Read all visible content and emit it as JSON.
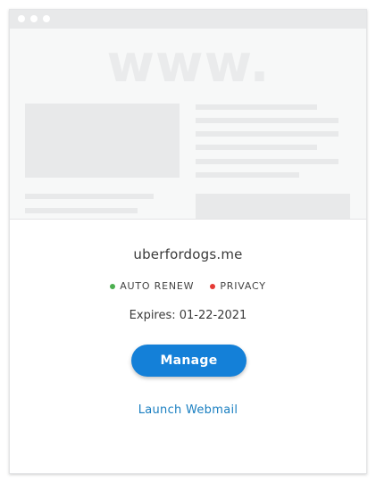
{
  "preview": {
    "watermark_text": "www.",
    "image_alt": "website-preview-placeholder"
  },
  "domain": {
    "name": "uberfordogs.me"
  },
  "statuses": [
    {
      "label": "AUTO RENEW",
      "color": "#4caf50"
    },
    {
      "label": "PRIVACY",
      "color": "#e53935"
    }
  ],
  "expires": {
    "text": "Expires: 01-22-2021"
  },
  "actions": {
    "manage_label": "Manage",
    "webmail_label": "Launch Webmail"
  },
  "colors": {
    "accent": "#1480d8",
    "link": "#1a7fc1"
  }
}
